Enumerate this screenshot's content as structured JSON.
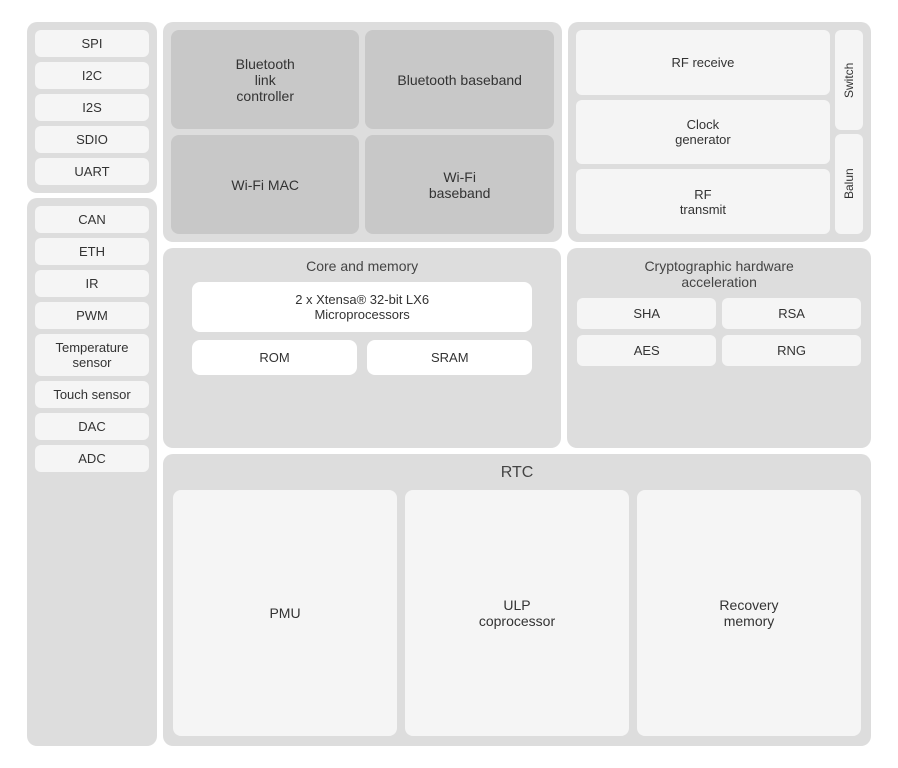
{
  "left": {
    "group1": {
      "items": [
        "SPI",
        "I2C",
        "I2S",
        "SDIO",
        "UART"
      ]
    },
    "group2": {
      "items": [
        "CAN",
        "ETH",
        "IR",
        "PWM",
        "Temperature\nsensor",
        "Touch sensor",
        "DAC",
        "ADC"
      ]
    }
  },
  "bluetooth": {
    "controller": "Bluetooth\nlink\ncontroller",
    "baseband": "Bluetooth\nbaseband",
    "wifi_mac": "Wi-Fi MAC",
    "wifi_baseband": "Wi-Fi\nbaseband"
  },
  "rf": {
    "receive": "RF receive",
    "clock": "Clock\ngenerator",
    "transmit": "RF\ntransmit",
    "switch": "Switch",
    "balun": "Balun"
  },
  "core": {
    "title": "Core and memory",
    "processor": "2 x Xtensa® 32-bit LX6\nMicroprocessors",
    "rom": "ROM",
    "sram": "SRAM"
  },
  "crypto": {
    "title": "Cryptographic hardware\nacceleration",
    "items": [
      "SHA",
      "RSA",
      "AES",
      "RNG"
    ]
  },
  "rtc": {
    "title": "RTC",
    "pmu": "PMU",
    "ulp": "ULP\ncoprocessor",
    "recovery": "Recovery\nmemory"
  }
}
